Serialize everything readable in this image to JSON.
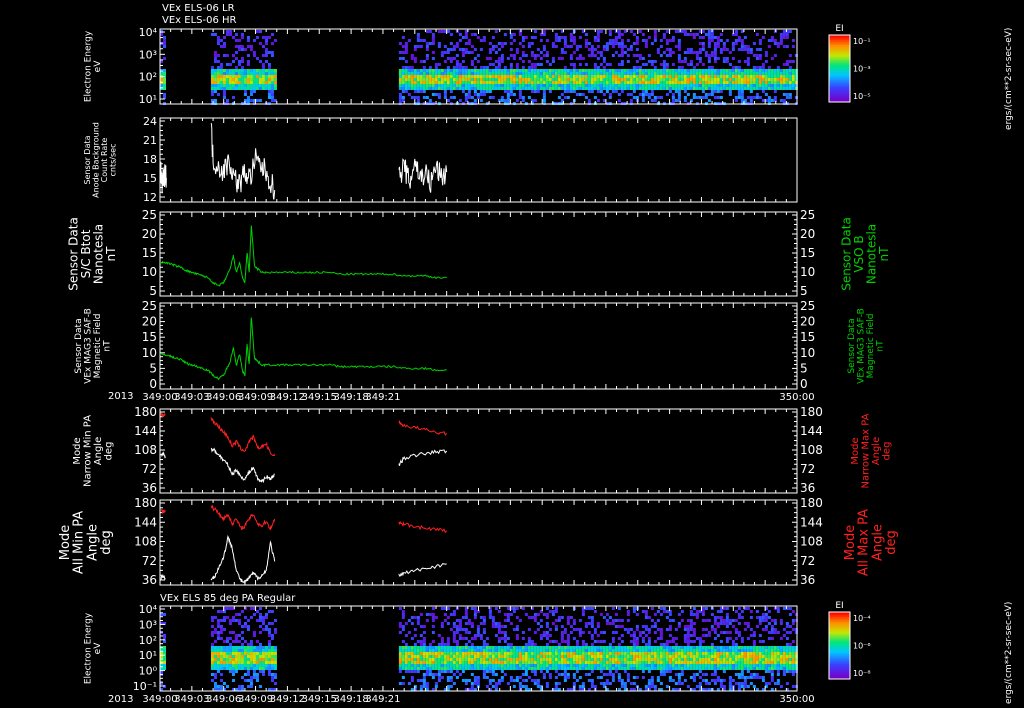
{
  "headers": {
    "title_lr": "VEx ELS-06 LR",
    "title_hr": "VEx ELS-06 HR",
    "panel8_title": "VEx ELS 85 deg PA Regular"
  },
  "year_label_1": "2013",
  "year_label_2": "2013",
  "colorbar_unit": "ergs/(cm**2-sr-sec-eV)",
  "colors": {
    "background": "#000000",
    "frame": "#ffffff",
    "field": "#00d000",
    "maxpa": "#ff2020",
    "minpa": "#ffffff"
  },
  "chart_data": [
    {
      "type": "heatmap",
      "id": "electron_energy_1",
      "ylabel_lines": [
        "Electron Energy",
        "eV"
      ],
      "yscale": "log",
      "ylim": [
        10,
        10000
      ],
      "yticks": [
        "10⁴",
        "10³",
        "10²",
        "10¹"
      ],
      "colorbar": {
        "label": "EI",
        "ticks": [
          "10⁻¹",
          "10⁻³",
          "10⁻⁵"
        ]
      },
      "x_segments": [
        [
          "349:00",
          "349:00.5"
        ],
        [
          "349:04.8",
          "349:10.8"
        ],
        [
          "349:22.5",
          "350:00"
        ]
      ]
    },
    {
      "type": "line",
      "id": "background_counts",
      "ylabel_lines": [
        "Sensor Data",
        "Anode Background",
        "Count Rate",
        "cnts/sec"
      ],
      "yticks": [
        "24",
        "21",
        "18",
        "15",
        "12"
      ],
      "ylim": [
        10,
        24
      ],
      "series": [
        {
          "color": "white",
          "x": [
            0,
            0.1,
            0.2,
            0.3,
            0.4,
            0.5,
            0.6
          ],
          "y": [
            13,
            15,
            12.5,
            14,
            13.5,
            15.5,
            14
          ]
        },
        {
          "color": "white",
          "x": [
            4.8,
            5.0,
            5.5,
            6.0,
            6.5,
            7.0,
            7.5,
            8.0,
            8.5,
            9.0,
            9.5,
            10.0,
            10.5,
            10.8
          ],
          "y": [
            23,
            17,
            16,
            15,
            17,
            14,
            13,
            15,
            14,
            17,
            16,
            15,
            13,
            12
          ]
        },
        {
          "color": "white",
          "x": [
            22.5,
            23.0,
            23.5,
            24.0,
            24.5,
            25.0,
            25.5,
            26.0,
            26.5,
            27.0
          ],
          "y": [
            14,
            16,
            13,
            17,
            14,
            15,
            13,
            16,
            14,
            15
          ]
        }
      ]
    },
    {
      "type": "line",
      "id": "vso_b",
      "ylabel_lines": [
        "Sensor Data",
        "S/C Btot",
        "Nanotesla",
        "nT"
      ],
      "rlabel_lines": [
        "Sensor Data",
        "VSO B",
        "Nanotesla",
        "nT"
      ],
      "yticks": [
        "25",
        "20",
        "15",
        "10",
        "5"
      ],
      "ylim": [
        0,
        25
      ],
      "series": [
        {
          "color": "green",
          "x": [
            0,
            0.5,
            1,
            1.5,
            2,
            2.5,
            3,
            3.5,
            4,
            4.5,
            5,
            5.5,
            6,
            6.3,
            6.6,
            6.9,
            7.2,
            7.5,
            7.8,
            8.0,
            8.2,
            8.4,
            8.6,
            8.9,
            9.2,
            9.6,
            10,
            11,
            12,
            13,
            14,
            15,
            16,
            17,
            18,
            19,
            20,
            21,
            22,
            23,
            24,
            25,
            26,
            27
          ],
          "y": [
            10,
            10,
            9.5,
            9,
            8.5,
            7.5,
            7,
            6.5,
            6,
            5.5,
            4,
            3,
            4,
            6,
            8,
            12,
            7,
            10,
            5,
            4,
            13,
            7,
            21,
            9,
            8,
            7,
            7,
            7,
            7,
            7,
            7,
            7,
            7,
            6.5,
            6.5,
            6.5,
            6.5,
            6.5,
            6.5,
            6,
            6,
            6,
            5.5,
            5.5
          ]
        }
      ]
    },
    {
      "type": "line",
      "id": "mag3_saf",
      "ylabel_lines": [
        "Sensor Data",
        "VEx MAG3 SAF-B",
        "Magnetic Field",
        "nT"
      ],
      "rlabel_lines": [
        "Sensor Data",
        "VEx MAG3 SAF-B",
        "Magnetic Field",
        "nT"
      ],
      "yticks": [
        "25",
        "20",
        "15",
        "10",
        "5",
        "0"
      ],
      "ylim": [
        0,
        25
      ],
      "series": [
        {
          "color": "green",
          "x": [
            0,
            0.5,
            1,
            1.5,
            2,
            2.5,
            3,
            3.5,
            4,
            4.5,
            5,
            5.5,
            6,
            6.3,
            6.6,
            6.9,
            7.2,
            7.5,
            7.8,
            8.0,
            8.2,
            8.4,
            8.6,
            8.9,
            9.2,
            9.6,
            10,
            11,
            12,
            13,
            14,
            15,
            16,
            17,
            18,
            19,
            20,
            21,
            22,
            23,
            24,
            25,
            26,
            27
          ],
          "y": [
            10,
            10,
            9.5,
            9,
            8.5,
            7.5,
            7,
            6.5,
            6,
            5.5,
            4,
            3,
            4,
            6,
            8,
            12,
            7,
            10,
            5,
            4,
            13,
            7,
            21,
            9,
            8,
            7,
            7,
            7,
            7,
            7,
            7,
            7,
            7,
            6.5,
            6.5,
            6.5,
            6.5,
            6.5,
            6.5,
            6,
            6,
            6,
            5.5,
            5.5
          ]
        }
      ],
      "xticks": [
        "349:00",
        "349:03",
        "349:06",
        "349:09",
        "349:12",
        "349:15",
        "349:18",
        "349:21",
        "350:00"
      ]
    },
    {
      "type": "line",
      "id": "narrow_pa",
      "ylabel_lines": [
        "Mode",
        "Narrow Min PA",
        "Angle",
        "deg"
      ],
      "rlabel_lines": [
        "Mode",
        "Narrow Max PA",
        "Angle",
        "deg"
      ],
      "yticks": [
        "180",
        "144",
        "108",
        "72",
        "36"
      ],
      "ylim": [
        0,
        180
      ],
      "series": [
        {
          "color": "red",
          "x": [
            0.1,
            0.3,
            0.5
          ],
          "y": [
            170,
            165,
            168
          ]
        },
        {
          "color": "white",
          "x": [
            0.1,
            0.3,
            0.5
          ],
          "y": [
            80,
            85,
            78
          ]
        },
        {
          "color": "red",
          "x": [
            4.8,
            5.2,
            5.6,
            6.0,
            6.4,
            6.8,
            7.2,
            7.6,
            8.0,
            8.4,
            8.8,
            9.2,
            9.6,
            10.0,
            10.4,
            10.8
          ],
          "y": [
            160,
            150,
            140,
            130,
            120,
            100,
            110,
            95,
            90,
            110,
            120,
            95,
            100,
            105,
            85,
            80
          ]
        },
        {
          "color": "white",
          "x": [
            4.8,
            5.2,
            5.6,
            6.0,
            6.4,
            6.8,
            7.2,
            7.6,
            8.0,
            8.4,
            8.8,
            9.2,
            9.6,
            10.0,
            10.4,
            10.8
          ],
          "y": [
            95,
            90,
            80,
            70,
            60,
            40,
            50,
            35,
            30,
            45,
            55,
            30,
            25,
            35,
            30,
            40
          ]
        },
        {
          "color": "red",
          "x": [
            22.5,
            23,
            24,
            25,
            26,
            27
          ],
          "y": [
            150,
            145,
            140,
            135,
            130,
            128
          ]
        },
        {
          "color": "white",
          "x": [
            22.5,
            23,
            24,
            25,
            26,
            27
          ],
          "y": [
            60,
            75,
            80,
            85,
            88,
            90
          ]
        }
      ]
    },
    {
      "type": "line",
      "id": "all_pa",
      "ylabel_lines": [
        "Mode",
        "All Min PA",
        "Angle",
        "deg"
      ],
      "rlabel_lines": [
        "Mode",
        "All Max PA",
        "Angle",
        "deg"
      ],
      "yticks": [
        "180",
        "144",
        "108",
        "72",
        "36"
      ],
      "ylim": [
        0,
        180
      ],
      "series": [
        {
          "color": "red",
          "x": [
            0.1,
            0.3,
            0.5
          ],
          "y": [
            160,
            155,
            158
          ]
        },
        {
          "color": "white",
          "x": [
            0.1,
            0.3,
            0.5
          ],
          "y": [
            15,
            20,
            12
          ]
        },
        {
          "color": "red",
          "x": [
            4.8,
            5.2,
            5.6,
            6.0,
            6.4,
            6.8,
            7.2,
            7.6,
            8.0,
            8.4,
            8.8,
            9.2,
            9.6,
            10.0,
            10.4,
            10.8
          ],
          "y": [
            165,
            160,
            150,
            140,
            150,
            130,
            140,
            120,
            125,
            140,
            150,
            130,
            125,
            135,
            120,
            140
          ]
        },
        {
          "color": "white",
          "x": [
            4.8,
            5.2,
            5.6,
            6.0,
            6.4,
            6.8,
            7.2,
            7.6,
            8.0,
            8.4,
            8.8,
            9.2,
            9.6,
            10.0,
            10.4,
            10.8
          ],
          "y": [
            10,
            20,
            40,
            60,
            100,
            80,
            30,
            10,
            5,
            15,
            25,
            15,
            20,
            30,
            90,
            50
          ]
        },
        {
          "color": "red",
          "x": [
            22.5,
            23,
            24,
            25,
            26,
            27
          ],
          "y": [
            130,
            128,
            125,
            120,
            118,
            115
          ]
        },
        {
          "color": "white",
          "x": [
            22.5,
            23,
            24,
            25,
            26,
            27
          ],
          "y": [
            20,
            25,
            30,
            35,
            40,
            45
          ]
        }
      ]
    },
    {
      "type": "heatmap",
      "id": "electron_energy_2",
      "ylabel_lines": [
        "Electron Energy",
        "eV"
      ],
      "yscale": "log",
      "ylim": [
        1,
        10000
      ],
      "yticks": [
        "10⁴",
        "10³",
        "10²",
        "10¹",
        "10⁰",
        "10⁻¹"
      ],
      "colorbar": {
        "label": "EI",
        "ticks": [
          "10⁻⁴",
          "10⁻⁶",
          "10⁻⁸"
        ]
      },
      "xticks": [
        "349:00",
        "349:03",
        "349:06",
        "349:09",
        "349:12",
        "349:15",
        "349:18",
        "349:21",
        "350:00"
      ],
      "x_segments": [
        [
          "349:00",
          "349:00.5"
        ],
        [
          "349:04.8",
          "349:10.8"
        ],
        [
          "349:22.5",
          "350:00"
        ]
      ]
    }
  ]
}
